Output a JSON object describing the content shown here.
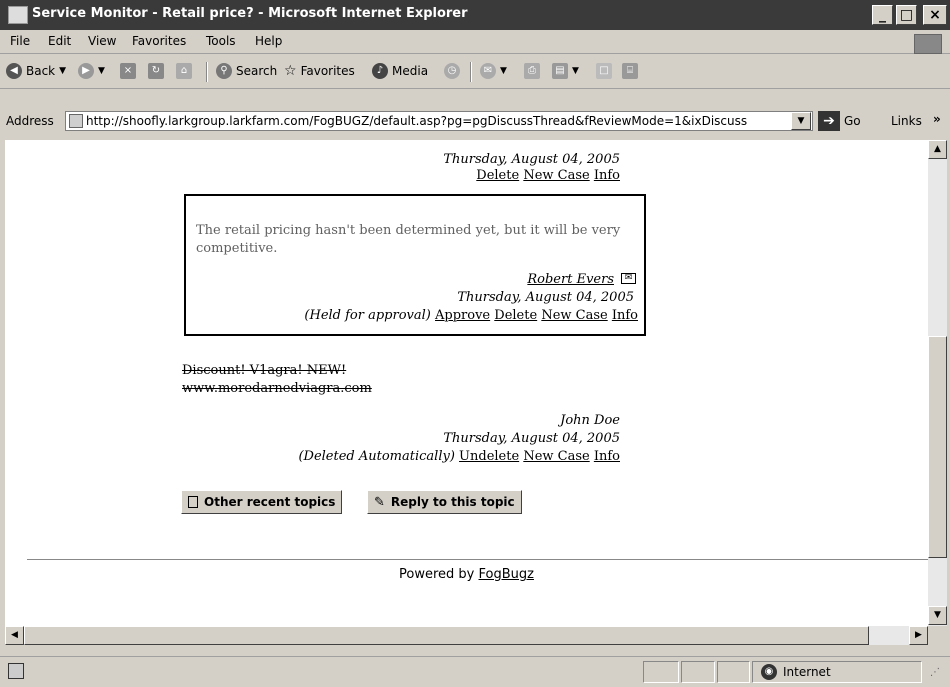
{
  "window": {
    "title": "Service Monitor - Retail price? - Microsoft Internet Explorer",
    "minimize": "_",
    "maximize": "□",
    "close": "×"
  },
  "menu": {
    "items": [
      "File",
      "Edit",
      "View",
      "Favorites",
      "Tools",
      "Help"
    ]
  },
  "toolbar": {
    "back": "Back",
    "search": "Search",
    "favorites": "Favorites",
    "media": "Media"
  },
  "address": {
    "label": "Address",
    "url": "http://shoofly.larkgroup.larkfarm.com/FogBUGZ/default.asp?pg=pgDiscussThread&fReviewMode=1&ixDiscuss",
    "go": "Go",
    "links": "Links",
    "links_more": "»"
  },
  "content": {
    "post1": {
      "date": "Thursday, August 04, 2005",
      "actions": [
        "Delete",
        "New Case",
        "Info"
      ]
    },
    "post2": {
      "text": "The retail pricing hasn't been determined yet, but it will be very competitive.",
      "author": "Robert Evers",
      "date": "Thursday, August 04, 2005",
      "status": "(Held for approval)",
      "actions": [
        "Approve",
        "Delete",
        "New Case",
        "Info"
      ]
    },
    "post3": {
      "spam_line1": "Discount! V1agra! NEW!",
      "spam_line2": "www.moredarnedviagra.com",
      "author": "John Doe",
      "date": "Thursday, August 04, 2005",
      "status": "(Deleted Automatically)",
      "actions": [
        "Undelete",
        "New Case",
        "Info"
      ]
    },
    "buttons": {
      "other_topics": "Other recent topics",
      "reply": "Reply to this topic"
    },
    "powered_by": "Powered by",
    "powered_link": "FogBugz"
  },
  "status": {
    "zone": "Internet"
  }
}
